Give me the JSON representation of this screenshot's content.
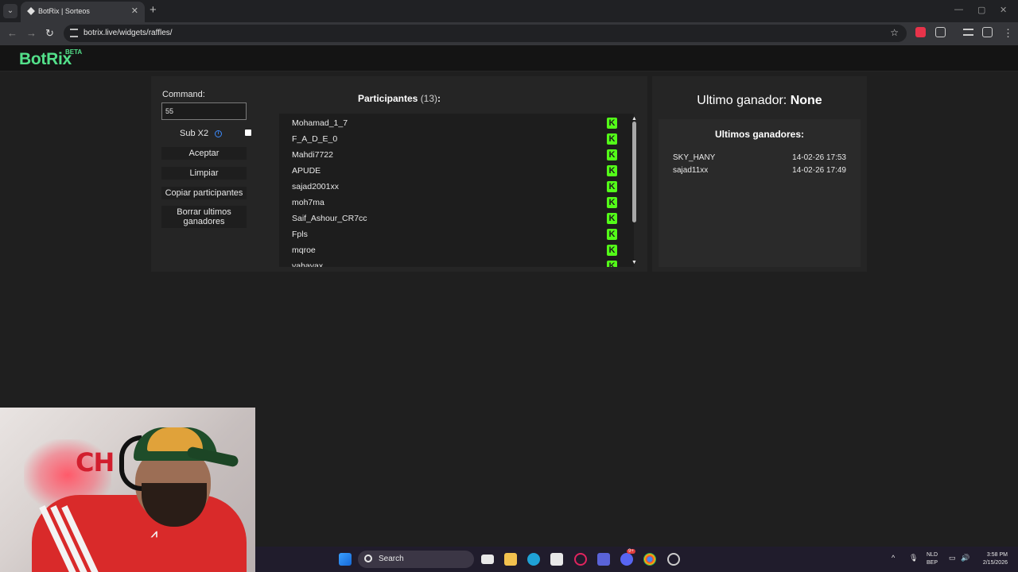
{
  "browser": {
    "tab_title": "BotRix | Sorteos",
    "url": "botrix.live/widgets/raffles/"
  },
  "site": {
    "logo": "BotRix",
    "badge": "BETA"
  },
  "controls": {
    "command_label": "Command:",
    "command_value": "55",
    "sub_label": "Sub X2",
    "sub_checked": false,
    "buttons": [
      "Aceptar",
      "Limpiar",
      "Copiar participantes",
      "Borrar ultimos ganadores"
    ]
  },
  "participants": {
    "title": "Participantes",
    "count_text": "(13)",
    "colon": ":",
    "visible": [
      "Mohamad_1_7",
      "F_A_D_E_0",
      "Mahdi7722",
      "APUDE",
      "sajad2001xx",
      "moh7ma",
      "Saif_Ashour_CR7cc",
      "Fpls",
      "mqroe",
      "yahayax"
    ],
    "platform_icon": "kick-icon",
    "platform_color": "#53fc18"
  },
  "winner": {
    "label": "Ultimo ganador:",
    "value": "None"
  },
  "recent_winners": {
    "title": "Ultimos ganadores:",
    "items": [
      {
        "name": "SKY_HANY",
        "date": "14-02-26 17:53"
      },
      {
        "name": "sajad11xx",
        "date": "14-02-26 17:49"
      }
    ]
  },
  "taskbar": {
    "search_text": "Search",
    "lang_1": "NLD",
    "lang_2": "BEP",
    "time": "3:58 PM",
    "date": "2/15/2026",
    "discord_badge": "9+"
  },
  "colors": {
    "accent": "#53e08a",
    "kick_green": "#53fc18",
    "info_blue": "#3d8bfd"
  }
}
